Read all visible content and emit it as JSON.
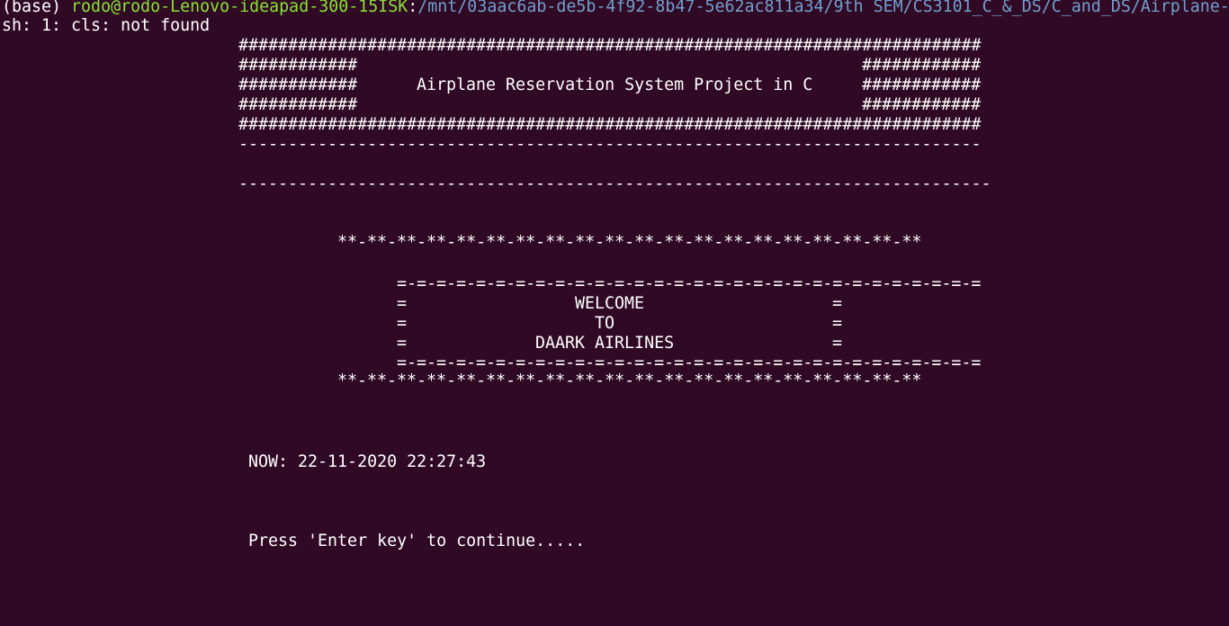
{
  "colors": {
    "background": "#300a24",
    "foreground": "#ffffff",
    "prompt_user": "#8ae234",
    "prompt_path": "#729fcf"
  },
  "prompt": {
    "env": "(base) ",
    "user_host": "rodo@rodo-Lenovo-ideapad-300-15ISK",
    "separator": ":",
    "path": "/mnt/03aac6ab-de5b-4f92-8b47-5e62ac811a34/9th SEM/CS3101_C_&_DS/C_and_DS/Airplane-"
  },
  "error_line": "sh: 1: cls: not found",
  "banner": {
    "border_full": "###########################################################################",
    "side_block": "############",
    "title": "Airplane Reservation System Project in C",
    "dashes_1": "---------------------------------------------------------------------------",
    "dashes_2": "----------------------------------------------------------------------------"
  },
  "welcome_box": {
    "stars": "**-**-**-**-**-**-**-**-**-**-**-**-**-**-**-**-**-**-**-**",
    "border": "=-=-=-=-=-=-=-=-=-=-=-=-=-=-=-=-=-=-=-=-=-=-=-=-=-=-=-=-=-=",
    "edge": "=",
    "line1": "WELCOME",
    "line2": "TO",
    "line3": "DAARK AIRLINES"
  },
  "datetime_line": "NOW: 22-11-2020 22:27:43",
  "continue_prompt": "Press 'Enter key' to continue....."
}
